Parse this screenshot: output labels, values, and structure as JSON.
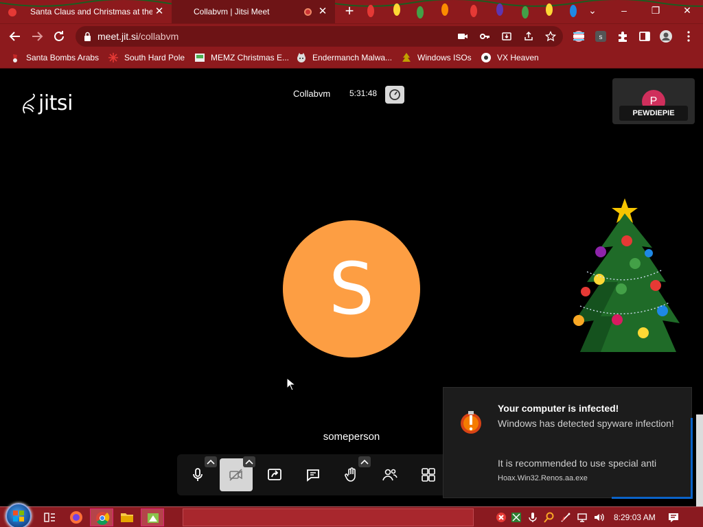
{
  "browser": {
    "tabs": [
      {
        "title": "Santa Claus and Christmas at the",
        "active": false
      },
      {
        "title": "Collabvm | Jitsi Meet",
        "active": true,
        "recording": true
      }
    ],
    "new_tab_label": "+",
    "window_controls": {
      "minimize": "–",
      "restore": "❐",
      "close": "✕",
      "tab_search": "⌄"
    },
    "address": {
      "host": "meet.jit.si",
      "path": "/collabvm"
    },
    "toolbar_icons": [
      "camera-icon",
      "key-icon",
      "install-icon",
      "share-icon",
      "star-icon",
      "profile-flag-icon",
      "extension-s-icon",
      "extensions-icon",
      "sidepanel-icon",
      "account-icon",
      "menu-icon"
    ],
    "bookmarks": [
      {
        "label": "Santa Bombs Arabs",
        "icon": "santa-icon"
      },
      {
        "label": "South Hard Pole",
        "icon": "snowflake-icon"
      },
      {
        "label": "MEMZ Christmas E...",
        "icon": "memz-icon"
      },
      {
        "label": "Endermanch Malwa...",
        "icon": "cat-icon"
      },
      {
        "label": "Windows ISOs",
        "icon": "tree-icon"
      },
      {
        "label": "VX Heaven",
        "icon": "vx-icon"
      }
    ]
  },
  "meeting": {
    "brand": "jitsi",
    "name": "Collabvm",
    "timer": "5:31:48",
    "remote_participant": {
      "initial": "P",
      "name": "PEWDIEPIE"
    },
    "main_participant": {
      "initial": "S",
      "name": "someperson"
    },
    "toolbar_buttons": [
      "microphone",
      "camera-off",
      "share-screen",
      "chat",
      "raise-hand",
      "participants",
      "tile-view"
    ]
  },
  "toast": {
    "title": "Your computer is infected!",
    "body": "Windows has detected spyware infection!",
    "recommend": "It is recommended to use special anti",
    "file": "Hoax.Win32.Renos.aa.exe"
  },
  "taskbar": {
    "clock": "8:29:03 AM",
    "pinned": [
      "task-view-icon",
      "firefox-icon",
      "chrome-icon",
      "explorer-icon",
      "vm-icon"
    ]
  },
  "colors": {
    "chrome_red": "#8d1a1d",
    "avatar_orange": "#fd9e43",
    "avatar_pink": "#cf2f5c",
    "accent_blue": "#0a63c9"
  }
}
